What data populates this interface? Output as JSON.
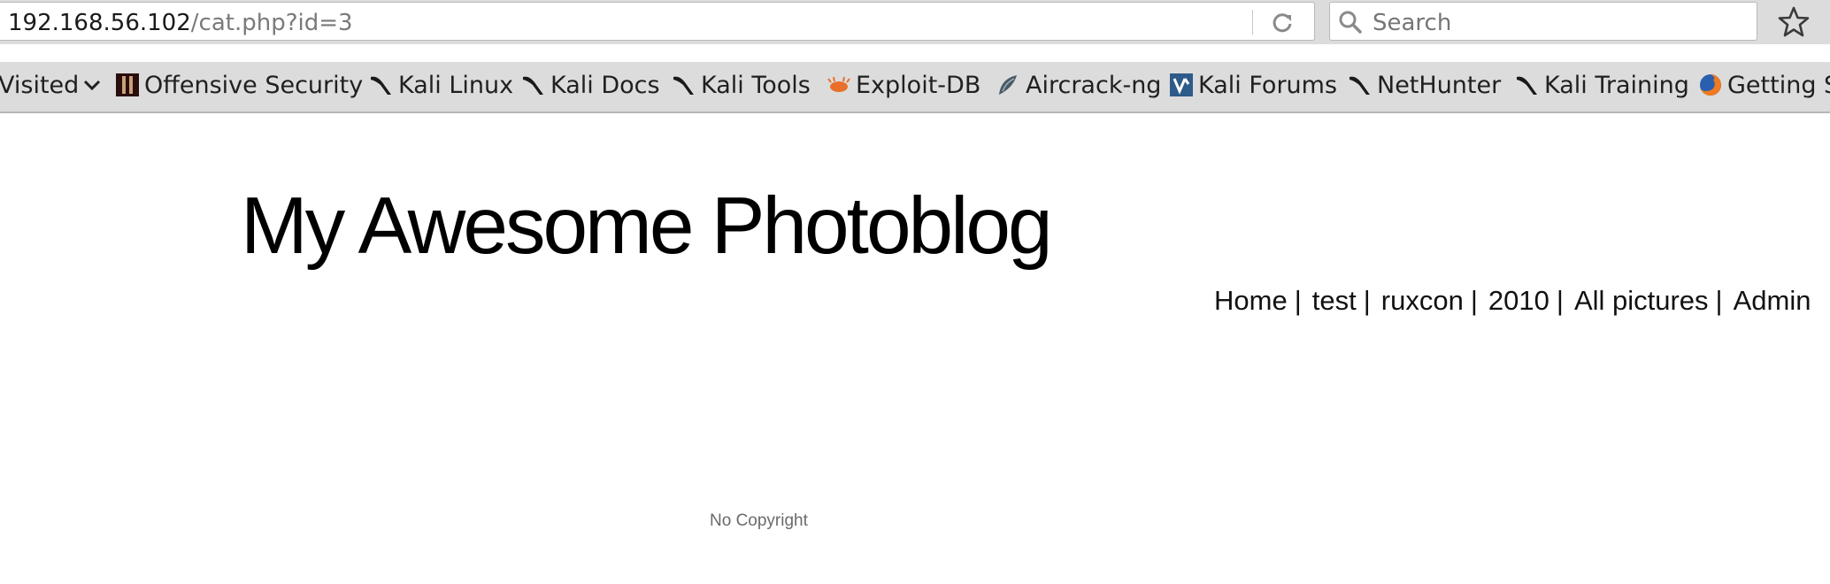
{
  "browser": {
    "url_host": "192.168.56.102",
    "url_path": "/cat.php?id=3",
    "search_placeholder": "Search"
  },
  "bookmarks": [
    {
      "label": "Visited",
      "icon": "chevron-down-icon"
    },
    {
      "label": "Offensive Security",
      "icon": "offensive-security-icon"
    },
    {
      "label": "Kali Linux",
      "icon": "kali-dragon-icon"
    },
    {
      "label": "Kali Docs",
      "icon": "kali-dragon-icon"
    },
    {
      "label": "Kali Tools",
      "icon": "kali-dragon-icon"
    },
    {
      "label": "Exploit-DB",
      "icon": "exploit-db-icon"
    },
    {
      "label": "Aircrack-ng",
      "icon": "aircrack-ng-icon"
    },
    {
      "label": "Kali Forums",
      "icon": "kali-forums-icon"
    },
    {
      "label": "NetHunter",
      "icon": "kali-dragon-icon"
    },
    {
      "label": "Kali Training",
      "icon": "kali-dragon-icon"
    },
    {
      "label": "Getting S",
      "icon": "firefox-icon"
    }
  ],
  "page": {
    "title": "My Awesome Photoblog",
    "nav": [
      {
        "label": "Home"
      },
      {
        "label": "test"
      },
      {
        "label": "ruxcon"
      },
      {
        "label": "2010"
      },
      {
        "label": "All pictures"
      },
      {
        "label": "Admin"
      }
    ],
    "nav_separator": "|",
    "footer": "No Copyright"
  }
}
